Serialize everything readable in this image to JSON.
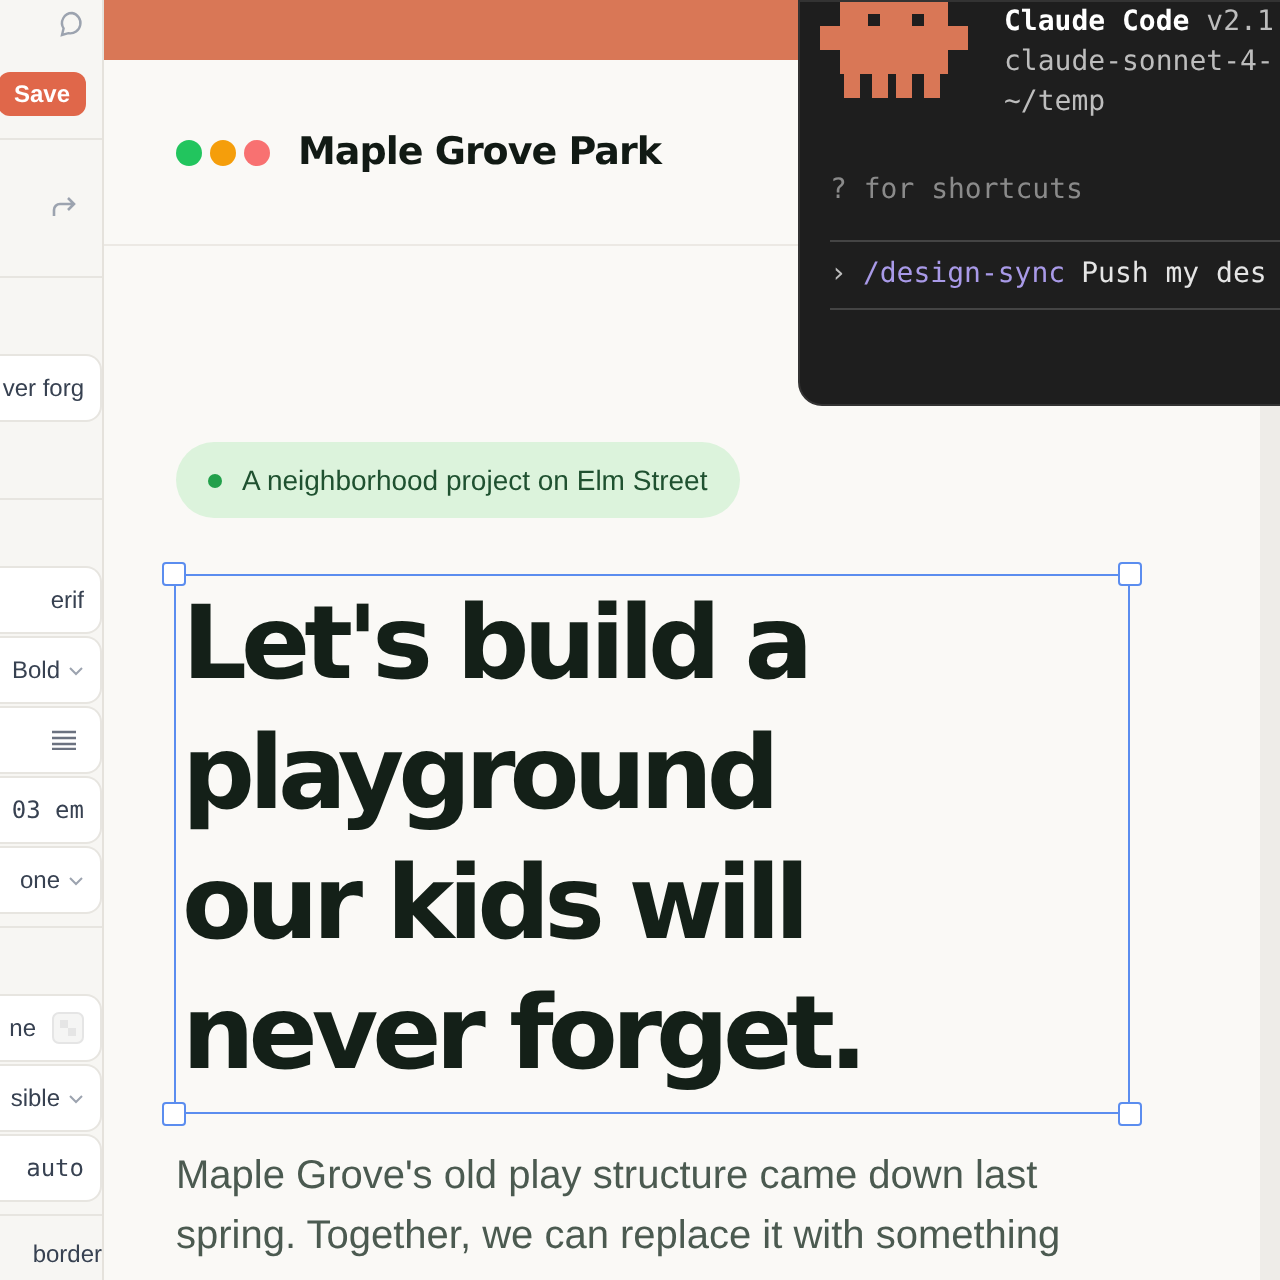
{
  "panel": {
    "save_button": "Save",
    "groups": [
      {
        "rows": [
          {
            "kind": "redo"
          }
        ]
      },
      {
        "rows": [
          {
            "kind": "field",
            "text": "ver forg"
          }
        ]
      },
      {
        "rows": [
          {
            "kind": "field",
            "text": "erif"
          },
          {
            "kind": "select",
            "text": "Bold"
          },
          {
            "kind": "align"
          },
          {
            "kind": "mono",
            "text": "03 em"
          },
          {
            "kind": "select",
            "text": "one"
          }
        ]
      },
      {
        "rows": [
          {
            "kind": "swatch",
            "text": "ne"
          },
          {
            "kind": "select",
            "text": "sible"
          },
          {
            "kind": "mono",
            "text": "auto"
          }
        ]
      }
    ],
    "footer_label": "border"
  },
  "site": {
    "brand": "Maple Grove Park",
    "dots": [
      {
        "color": "#22c55e"
      },
      {
        "color": "#f59e0b"
      },
      {
        "color": "#f87171"
      }
    ],
    "badge": "A neighborhood project on Elm Street",
    "heading": [
      "Let's build a",
      "playground",
      "our kids will",
      "never forget."
    ],
    "selected": true,
    "paragraph": [
      "Maple Grove's old play structure came down last",
      "spring. Together, we can replace it with something"
    ]
  },
  "terminal": {
    "app": "Claude Code",
    "version": "v2.1",
    "model": "claude-sonnet-4-",
    "path": "~/temp",
    "hint": "? for shortcuts",
    "prompt": "›",
    "command": "/design-sync",
    "input": "Push my des"
  }
}
